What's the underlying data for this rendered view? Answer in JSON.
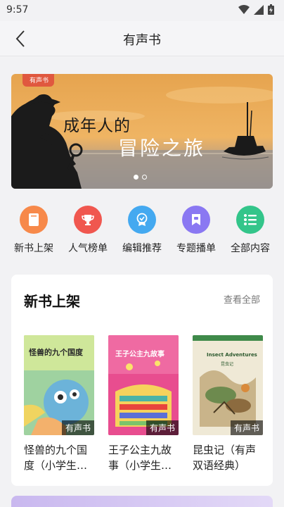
{
  "status": {
    "time": "9:57",
    "icons": [
      "wifi-icon",
      "signal-icon",
      "battery-icon"
    ]
  },
  "nav": {
    "title": "有声书",
    "back_icon": "chevron-left-icon"
  },
  "banner": {
    "tag": "有声书",
    "line1": "成年人的",
    "line2": "冒险之旅",
    "page_count": 2,
    "active_page": 1
  },
  "quick_nav": [
    {
      "label": "新书上架",
      "icon": "book-icon",
      "color": "#f7894a"
    },
    {
      "label": "人气榜单",
      "icon": "trophy-icon",
      "color": "#f0574f"
    },
    {
      "label": "编辑推荐",
      "icon": "badge-icon",
      "color": "#44a9f0"
    },
    {
      "label": "专题播单",
      "icon": "bookmark-icon",
      "color": "#8a78f2"
    },
    {
      "label": "全部内容",
      "icon": "list-icon",
      "color": "#33c58a"
    }
  ],
  "new_books": {
    "title": "新书上架",
    "see_all": "查看全部",
    "books": [
      {
        "cover_title": "怪兽的九个国度",
        "badge": "有声书",
        "title": "怪兽的九个国度（小学生…"
      },
      {
        "cover_title": "王子公主九故事",
        "badge": "有声书",
        "title": "王子公主九故事（小学生…"
      },
      {
        "cover_title": "Insect Adventures",
        "cover_subtitle": "昆虫记",
        "badge": "有声书",
        "title": "昆虫记（有声双语经典）"
      }
    ]
  }
}
